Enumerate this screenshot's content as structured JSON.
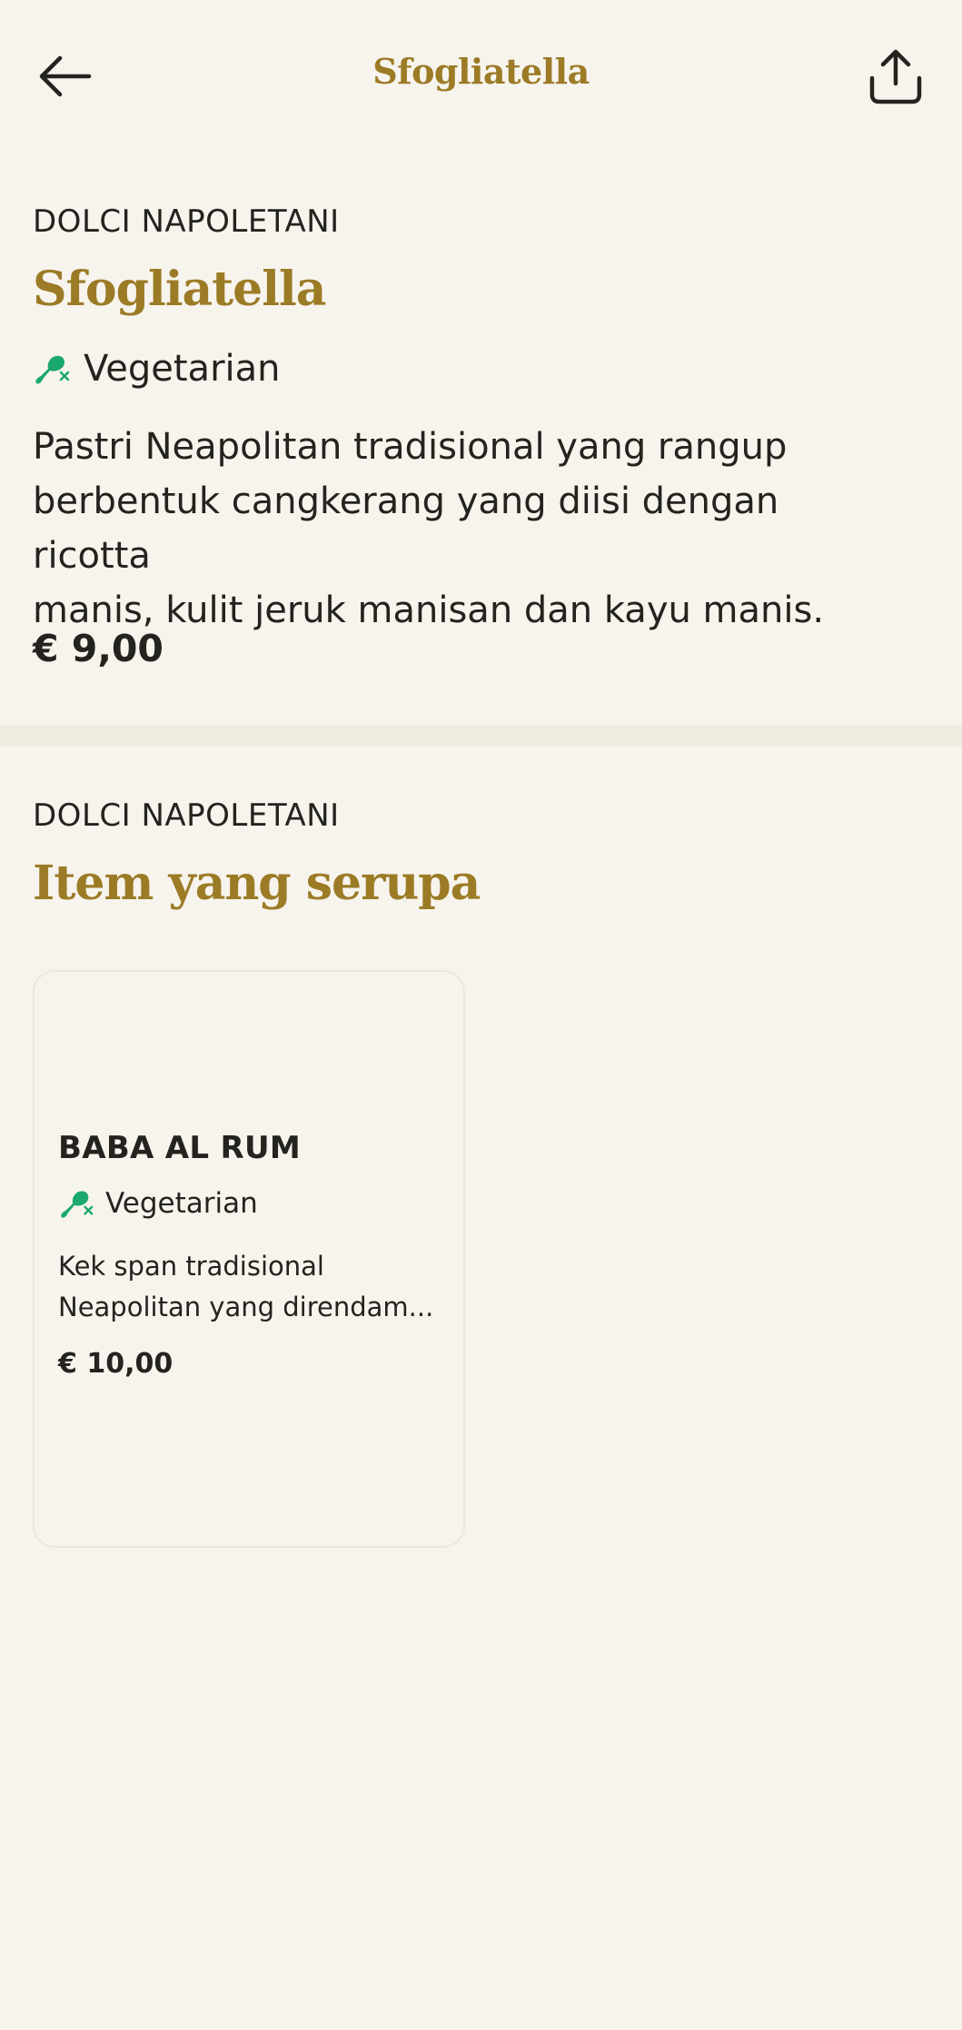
{
  "header": {
    "title": "Sfogliatella",
    "back_icon": "arrow-left-icon",
    "share_icon": "share-upload-icon"
  },
  "product": {
    "category": "DOLCI NAPOLETANI",
    "name": "Sfogliatella",
    "diet_label": "Vegetarian",
    "diet_icon": "no-meat-icon",
    "description_lines": [
      "Pastri Neapolitan tradisional yang rangup",
      "berbentuk cangkerang yang diisi dengan ricotta",
      "manis, kulit jeruk manisan dan kayu manis."
    ],
    "price": "€ 9,00"
  },
  "similar": {
    "category": "DOLCI NAPOLETANI",
    "heading": "Item yang serupa",
    "items": [
      {
        "name": "BABA AL RUM",
        "diet_label": "Vegetarian",
        "description_lines": [
          "Kek span tradisional",
          "Neapolitan yang direndam..."
        ],
        "price": "€ 10,00"
      }
    ]
  },
  "colors": {
    "background": "#f7f4ee",
    "accent_gold": "#9c7b26",
    "text": "#24231d",
    "diet_green": "#1aa86f",
    "divider": "#efece2"
  }
}
